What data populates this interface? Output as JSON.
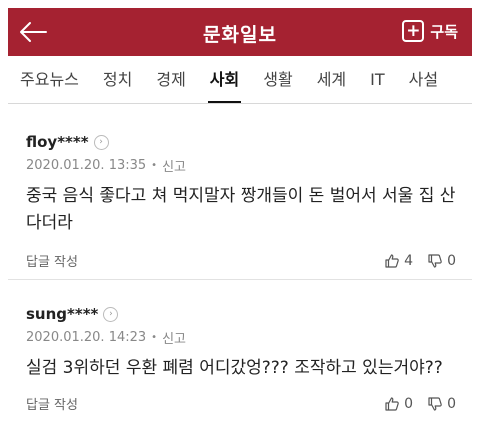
{
  "header": {
    "title": "문화일보",
    "subscribe_label": "구독",
    "accent_color": "#a52231"
  },
  "tabs": [
    {
      "label": "주요뉴스",
      "active": false
    },
    {
      "label": "정치",
      "active": false
    },
    {
      "label": "경제",
      "active": false
    },
    {
      "label": "사회",
      "active": true
    },
    {
      "label": "생활",
      "active": false
    },
    {
      "label": "세계",
      "active": false
    },
    {
      "label": "IT",
      "active": false
    },
    {
      "label": "사설",
      "active": false
    }
  ],
  "comments": [
    {
      "username": "floy****",
      "timestamp": "2020.01.20. 13:35",
      "report_label": "신고",
      "text": "중국 음식 좋다고 쳐 먹지말자 짱개들이 돈 벌어서 서울 집 산다더라",
      "reply_label": "답글 작성",
      "likes": "4",
      "dislikes": "0"
    },
    {
      "username": "sung****",
      "timestamp": "2020.01.20. 14:23",
      "report_label": "신고",
      "text": "실검 3위하던 우환 폐렴 어디갔엉??? 조작하고 있는거야??",
      "reply_label": "답글 작성",
      "likes": "0",
      "dislikes": "0"
    }
  ],
  "icons": {
    "back": "back-arrow-icon",
    "subscribe": "plus-icon",
    "profile": "chevron-right-icon",
    "like": "thumbs-up-icon",
    "dislike": "thumbs-down-icon"
  }
}
